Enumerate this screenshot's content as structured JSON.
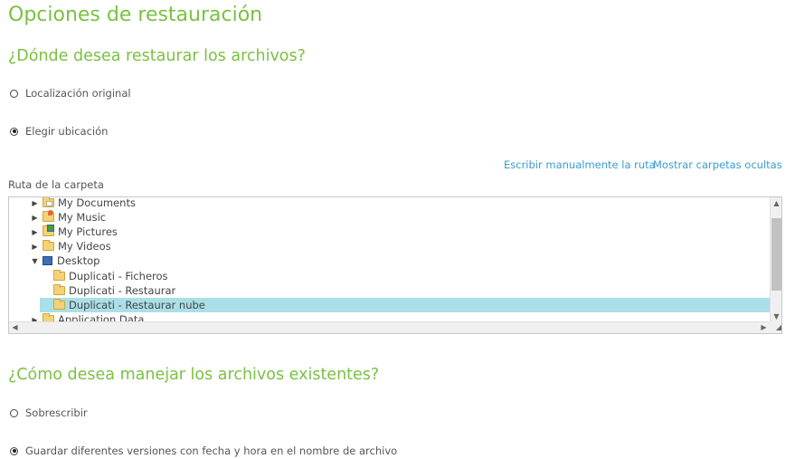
{
  "page": {
    "title": "Opciones de restauración",
    "restore_question": "¿Dónde desea restaurar los archivos?",
    "existing_question": "¿Cómo desea manejar los archivos existentes?"
  },
  "location": {
    "options": [
      {
        "label": "Localización original",
        "checked": false
      },
      {
        "label": "Elegir ubicación",
        "checked": true
      }
    ],
    "links": {
      "manual_path": "Escribir manualmente la ruta",
      "show_hidden": "Mostrar carpetas ocultas"
    },
    "folder_path_label": "Ruta de la carpeta"
  },
  "tree": {
    "items": [
      {
        "label": "My Documents",
        "icon": "folder-documents-icon",
        "expand": "collapsed"
      },
      {
        "label": "My Music",
        "icon": "folder-music-icon",
        "expand": "collapsed"
      },
      {
        "label": "My Pictures",
        "icon": "folder-pictures-icon",
        "expand": "collapsed"
      },
      {
        "label": "My Videos",
        "icon": "folder-icon",
        "expand": "collapsed"
      },
      {
        "label": "Desktop",
        "icon": "desktop-icon",
        "expand": "expanded"
      },
      {
        "label": "Duplicati - Ficheros",
        "icon": "folder-icon",
        "expand": "none"
      },
      {
        "label": "Duplicati - Restaurar",
        "icon": "folder-icon",
        "expand": "none"
      },
      {
        "label": "Duplicati - Restaurar nube",
        "icon": "folder-icon",
        "expand": "none",
        "selected": true
      },
      {
        "label": "Application Data",
        "icon": "folder-icon",
        "expand": "collapsed"
      }
    ]
  },
  "existing": {
    "options": [
      {
        "label": "Sobrescribir",
        "checked": false
      },
      {
        "label": "Guardar diferentes versiones con fecha y hora en el nombre de archivo",
        "checked": true
      }
    ]
  },
  "colors": {
    "accent_green": "#7ac142",
    "link_blue": "#3b9bd1",
    "selection": "#abdfe7"
  }
}
